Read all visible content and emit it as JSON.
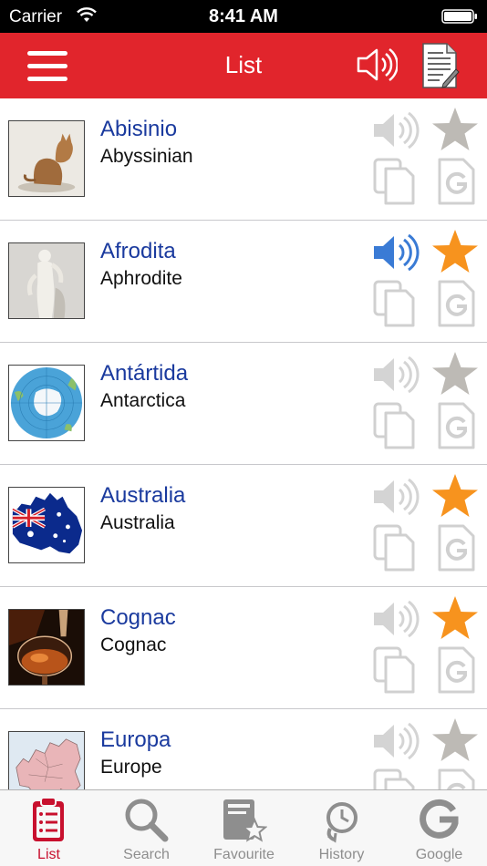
{
  "status_bar": {
    "carrier": "Carrier",
    "time": "8:41 AM"
  },
  "nav": {
    "title": "List"
  },
  "colors": {
    "brand_red": "#e1252c",
    "word_blue": "#1a3a9e",
    "star_orange": "#f7931e",
    "inactive_grey": "#bdbdbd",
    "sound_blue": "#3a7bd5"
  },
  "items": [
    {
      "word": "Abisinio",
      "translation": "Abyssinian",
      "favourite": false,
      "sound_active": false,
      "image": "cat"
    },
    {
      "word": "Afrodita",
      "translation": "Aphrodite",
      "favourite": true,
      "sound_active": true,
      "image": "statue"
    },
    {
      "word": "Antártida",
      "translation": "Antarctica",
      "favourite": false,
      "sound_active": false,
      "image": "globe"
    },
    {
      "word": "Australia",
      "translation": "Australia",
      "favourite": true,
      "sound_active": false,
      "image": "australia-flag-map"
    },
    {
      "word": "Cognac",
      "translation": "Cognac",
      "favourite": true,
      "sound_active": false,
      "image": "cognac-glass"
    },
    {
      "word": "Europa",
      "translation": "Europe",
      "favourite": false,
      "sound_active": false,
      "image": "europe-map"
    }
  ],
  "tabs": [
    {
      "label": "List",
      "icon": "clipboard-list-icon",
      "active": true
    },
    {
      "label": "Search",
      "icon": "magnifier-icon",
      "active": false
    },
    {
      "label": "Favourite",
      "icon": "book-star-icon",
      "active": false
    },
    {
      "label": "History",
      "icon": "clock-history-icon",
      "active": false
    },
    {
      "label": "Google",
      "icon": "google-icon",
      "active": false
    }
  ]
}
